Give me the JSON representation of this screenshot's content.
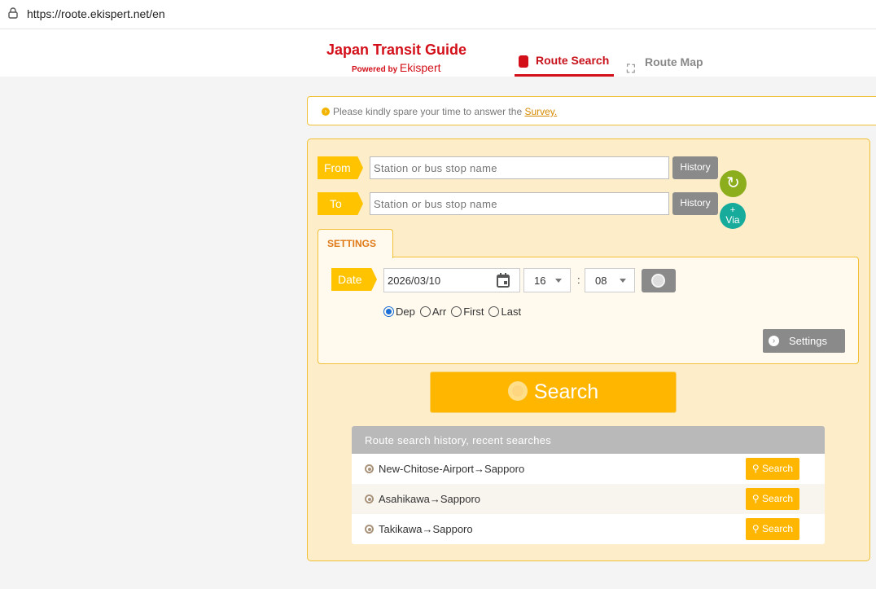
{
  "browser": {
    "url": "https://roote.ekispert.net/en"
  },
  "header": {
    "logo_title": "Japan Transit Guide",
    "logo_powered": "Powered by",
    "logo_brand": "Ekispert",
    "tabs": [
      {
        "label": "Route Search",
        "active": true
      },
      {
        "label": "Route Map",
        "active": false
      }
    ]
  },
  "survey": {
    "text": "Please kindly spare your time to answer the ",
    "link": "Survey."
  },
  "form": {
    "from_label": "From",
    "to_label": "To",
    "from_placeholder": "Station or bus stop name",
    "to_placeholder": "Station or bus stop name",
    "history_label": "History",
    "via_plus": "+",
    "via_label": "Via"
  },
  "settings": {
    "tab_label": "SETTINGS",
    "date_label": "Date",
    "date_value": "2026/03/10",
    "hour": "16",
    "minute": "08",
    "colon": ":",
    "options": [
      {
        "label": "Dep",
        "checked": true
      },
      {
        "label": "Arr",
        "checked": false
      },
      {
        "label": "First",
        "checked": false
      },
      {
        "label": "Last",
        "checked": false
      }
    ],
    "settings_button": "Settings"
  },
  "search_button": "Search",
  "history": {
    "title": "Route search history, recent searches",
    "search_label": "Search",
    "items": [
      "New-Chitose-Airport→Sapporo",
      "Asahikawa→Sapporo",
      "Takikawa→Sapporo"
    ]
  },
  "colors": {
    "accent": "#ffb600",
    "brand": "#d3101a",
    "panel": "#fdedc9"
  }
}
